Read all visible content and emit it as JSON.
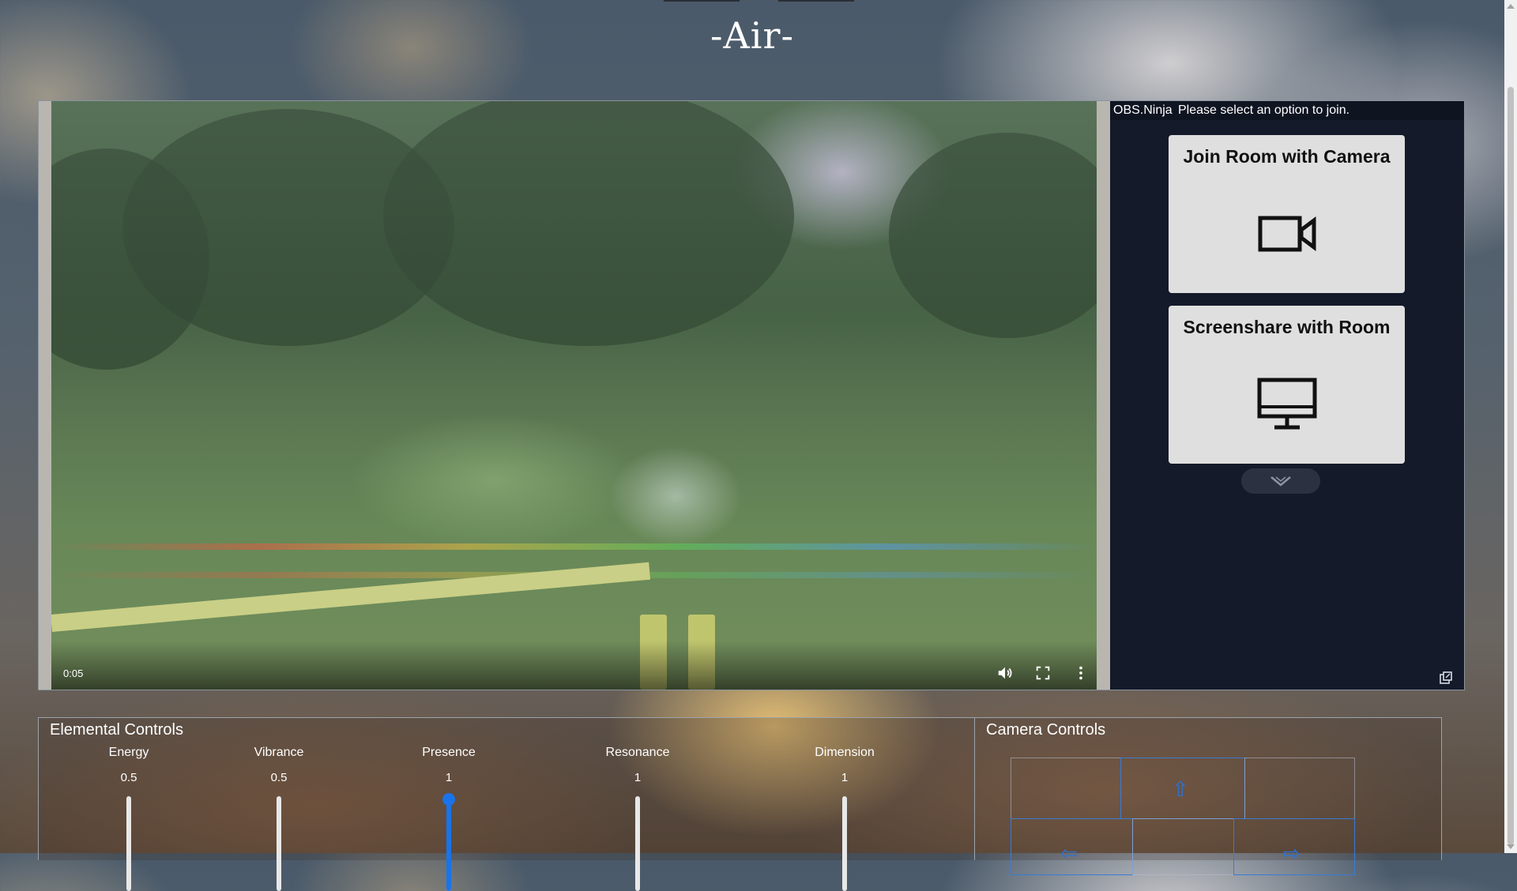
{
  "page": {
    "title": "-Air-"
  },
  "video": {
    "time": "0:05",
    "icons": {
      "volume": "volume-icon",
      "fullscreen": "fullscreen-icon",
      "more": "more-options-icon"
    }
  },
  "ninja": {
    "brand": "OBS.Ninja",
    "message": "Please select an option to join.",
    "join_camera_label": "Join Room with Camera",
    "screenshare_label": "Screenshare with Room",
    "icons": {
      "camera": "video-camera-icon",
      "screen": "monitor-icon",
      "more": "chevron-down-icon",
      "popout": "popout-icon"
    }
  },
  "elemental": {
    "title": "Elemental Controls",
    "sliders": [
      {
        "label": "Energy",
        "value": "0.5",
        "level": 0.5
      },
      {
        "label": "Vibrance",
        "value": "0.5",
        "level": 0.5
      },
      {
        "label": "Presence",
        "value": "1",
        "level": 1
      },
      {
        "label": "Resonance",
        "value": "1",
        "level": 1
      },
      {
        "label": "Dimension",
        "value": "1",
        "level": 1
      }
    ],
    "accent_color": "#1a73e8"
  },
  "camera": {
    "title": "Camera Controls",
    "icons": {
      "up": "arrow-up-icon",
      "left": "arrow-left-icon",
      "right": "arrow-right-icon"
    }
  }
}
